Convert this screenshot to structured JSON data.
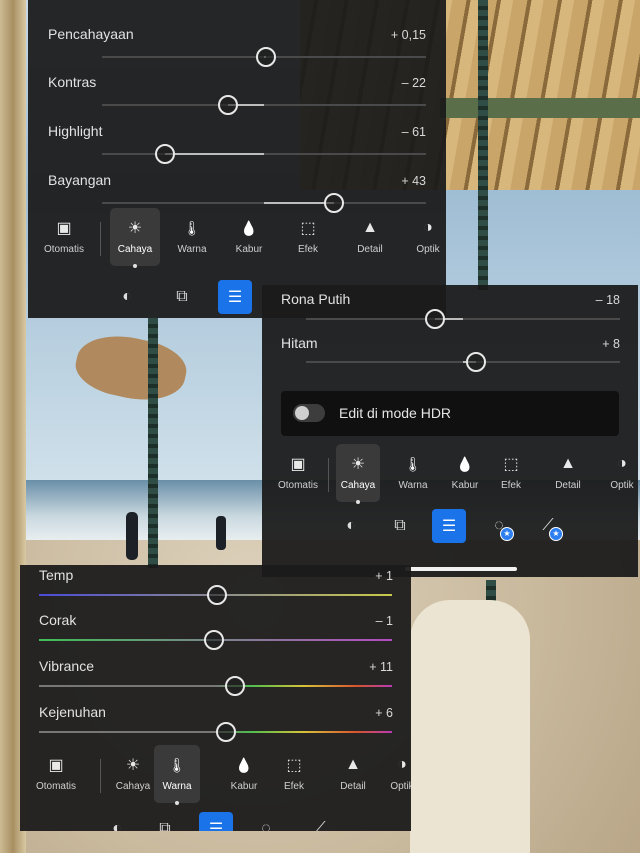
{
  "panel_light": {
    "sliders": [
      {
        "label": "Pencahayaan",
        "value": "+ 0,15",
        "level": 0.505
      },
      {
        "label": "Kontras",
        "value": "– 22",
        "level": 0.39
      },
      {
        "label": "Highlight",
        "value": "– 61",
        "level": 0.195
      },
      {
        "label": "Bayangan",
        "value": "+ 43",
        "level": 0.715
      }
    ],
    "tools": [
      "Otomatis",
      "Cahaya",
      "Warna",
      "Kabur",
      "Efek",
      "Detail",
      "Optik"
    ],
    "selected_tool": "Cahaya"
  },
  "panel_light2": {
    "sliders": [
      {
        "label": "Rona Putih",
        "value": "– 18",
        "level": 0.41
      },
      {
        "label": "Hitam",
        "value": "+ 8",
        "level": 0.54
      }
    ],
    "hdr_label": "Edit di mode HDR",
    "hdr_enabled": false,
    "tools": [
      "Otomatis",
      "Cahaya",
      "Warna",
      "Kabur",
      "Efek",
      "Detail",
      "Optik"
    ],
    "selected_tool": "Cahaya"
  },
  "panel_color": {
    "sliders": [
      {
        "label": "Temp",
        "value": "+ 1",
        "level": 0.505
      },
      {
        "label": "Corak",
        "value": "– 1",
        "level": 0.495
      },
      {
        "label": "Vibrance",
        "value": "+ 11",
        "level": 0.555
      },
      {
        "label": "Kejenuhan",
        "value": "+ 6",
        "level": 0.53
      }
    ],
    "tools": [
      "Otomatis",
      "Cahaya",
      "Warna",
      "Kabur",
      "Efek",
      "Detail",
      "Optik"
    ],
    "selected_tool": "Warna"
  },
  "icons": {
    "tools": [
      "auto-icon",
      "sun-icon",
      "thermometer-icon",
      "drop-icon",
      "vignette-icon",
      "triangle-icon",
      "lens-icon"
    ],
    "nav": [
      "mask-icon",
      "crop-icon",
      "adjust-icon",
      "healing-icon",
      "bandage-icon"
    ]
  },
  "colors": {
    "accent": "#1a73e8",
    "panel": "#1b1b1b"
  }
}
